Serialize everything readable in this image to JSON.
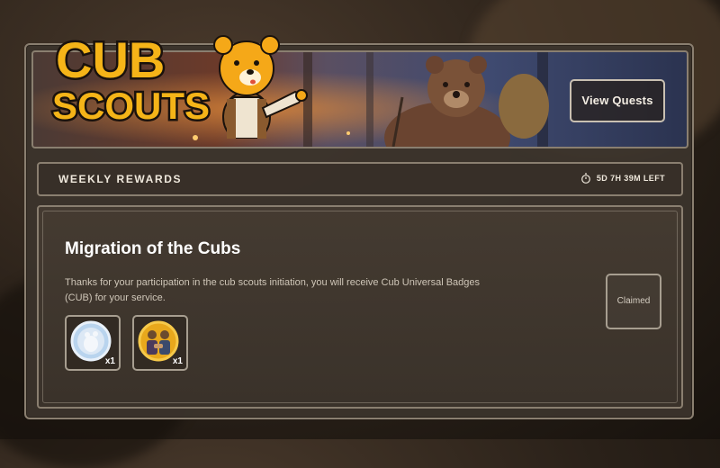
{
  "banner": {
    "logo_text_line1": "CUB",
    "logo_text_line2": "SCOUTS",
    "view_quests_label": "View Quests"
  },
  "weekly": {
    "title": "WEEKLY REWARDS",
    "time_left": "5D 7H 39M LEFT"
  },
  "quest": {
    "title": "Migration of the Cubs",
    "description": "Thanks for your participation in the cub scouts initiation, you will receive Cub Universal Badges (CUB) for your service.",
    "rewards": [
      {
        "icon": "cub-badge-icon",
        "quantity": "x1"
      },
      {
        "icon": "handshake-badge-icon",
        "quantity": "x1"
      }
    ],
    "status_label": "Claimed"
  },
  "colors": {
    "panel_border": "#8a7f70",
    "logo_yellow": "#f5b418",
    "text_light": "#efe8dc"
  }
}
